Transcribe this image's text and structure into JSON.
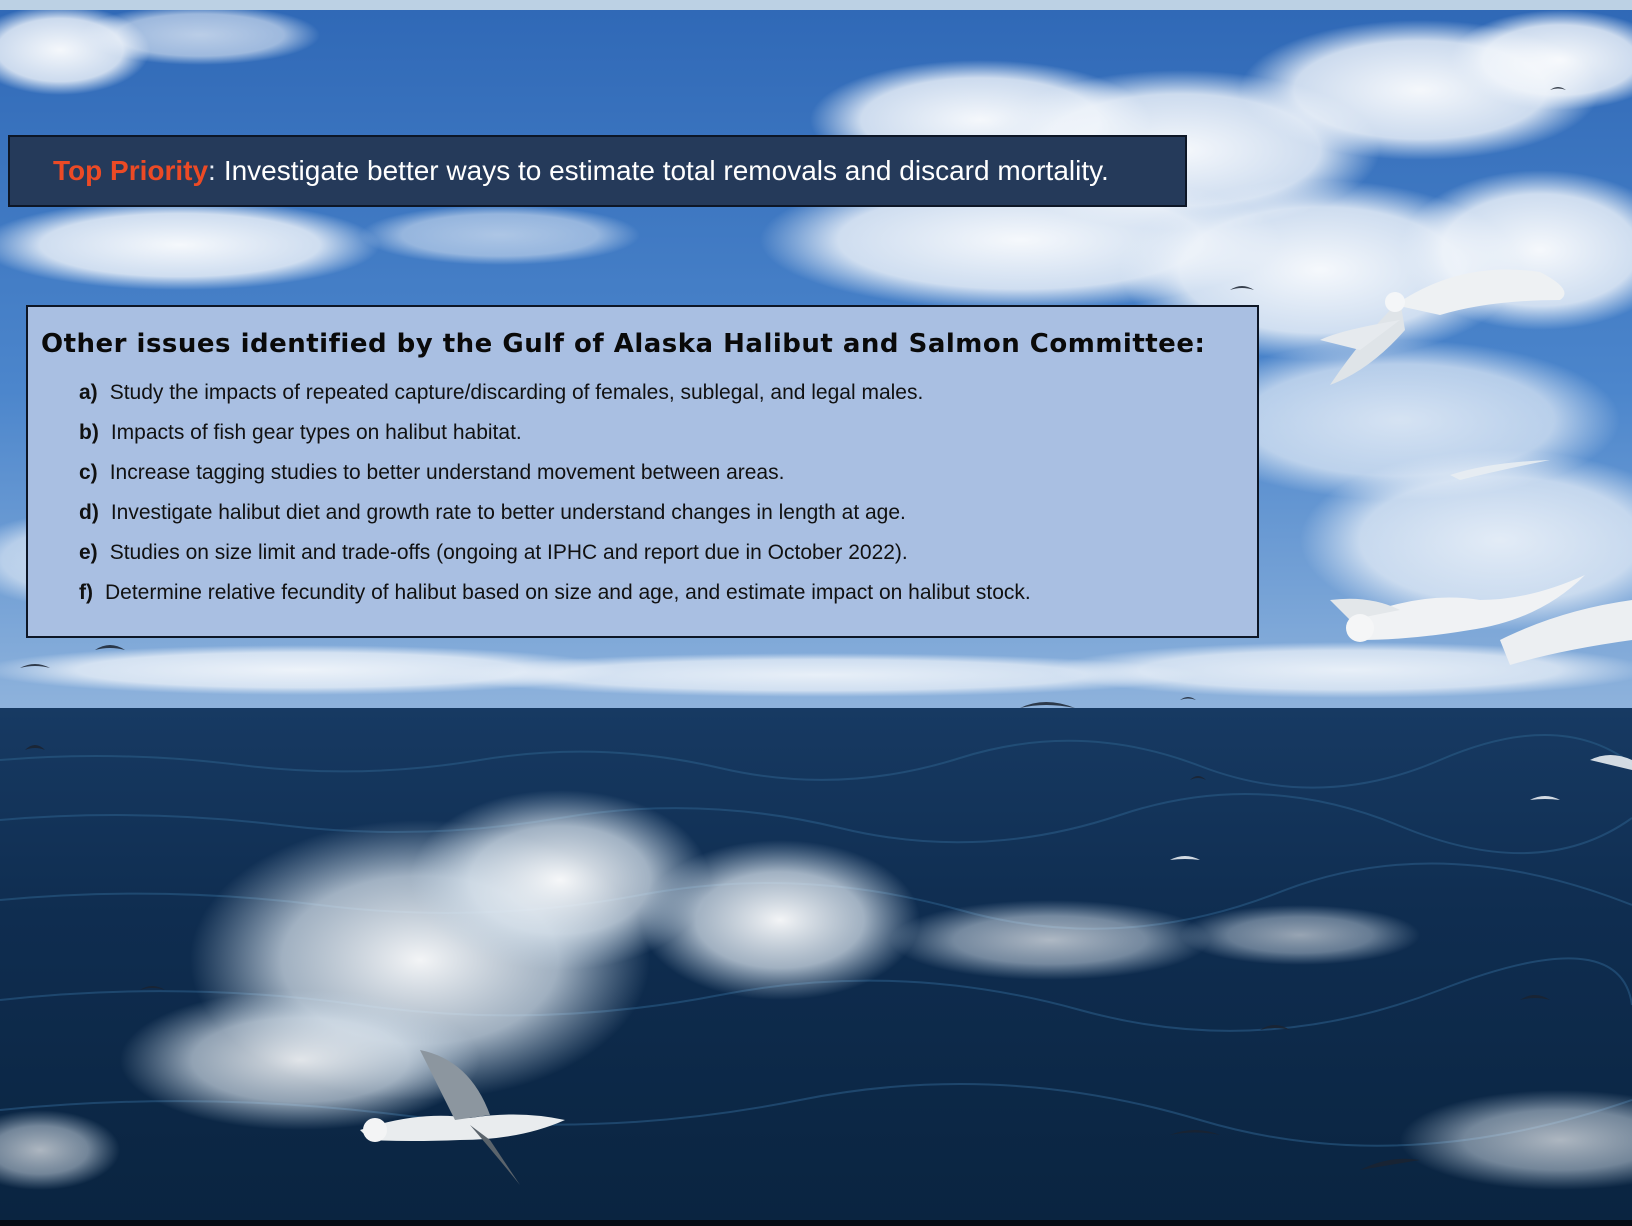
{
  "top_priority": {
    "label": "Top Priority",
    "separator": ":",
    "text": "Investigate better ways to estimate total removals and discard mortality."
  },
  "issues": {
    "title": "Other issues identified by the Gulf of Alaska Halibut and Salmon Committee:",
    "items": [
      {
        "letter": "a)",
        "text": "Study the impacts of repeated capture/discarding of females, sublegal, and legal males."
      },
      {
        "letter": "b)",
        "text": "Impacts of fish gear types on halibut habitat."
      },
      {
        "letter": "c)",
        "text": "Increase tagging studies to better understand movement between areas."
      },
      {
        "letter": "d)",
        "text": "Investigate halibut diet and growth rate to better understand changes in length at age."
      },
      {
        "letter": "e)",
        "text": "Studies on size limit and trade-offs (ongoing at IPHC and report due in October 2022)."
      },
      {
        "letter": "f)",
        "text": "Determine relative fecundity of halibut based on size and age, and estimate impact on halibut stock."
      }
    ]
  },
  "colors": {
    "priority_label": "#ec4a25",
    "priority_bg": "#253a5a",
    "issues_bg": "#a9bfe2",
    "sky": "#3f7ac4",
    "ocean": "#0f2c4e"
  },
  "background": {
    "icon": "ocean-seagulls-photo"
  }
}
